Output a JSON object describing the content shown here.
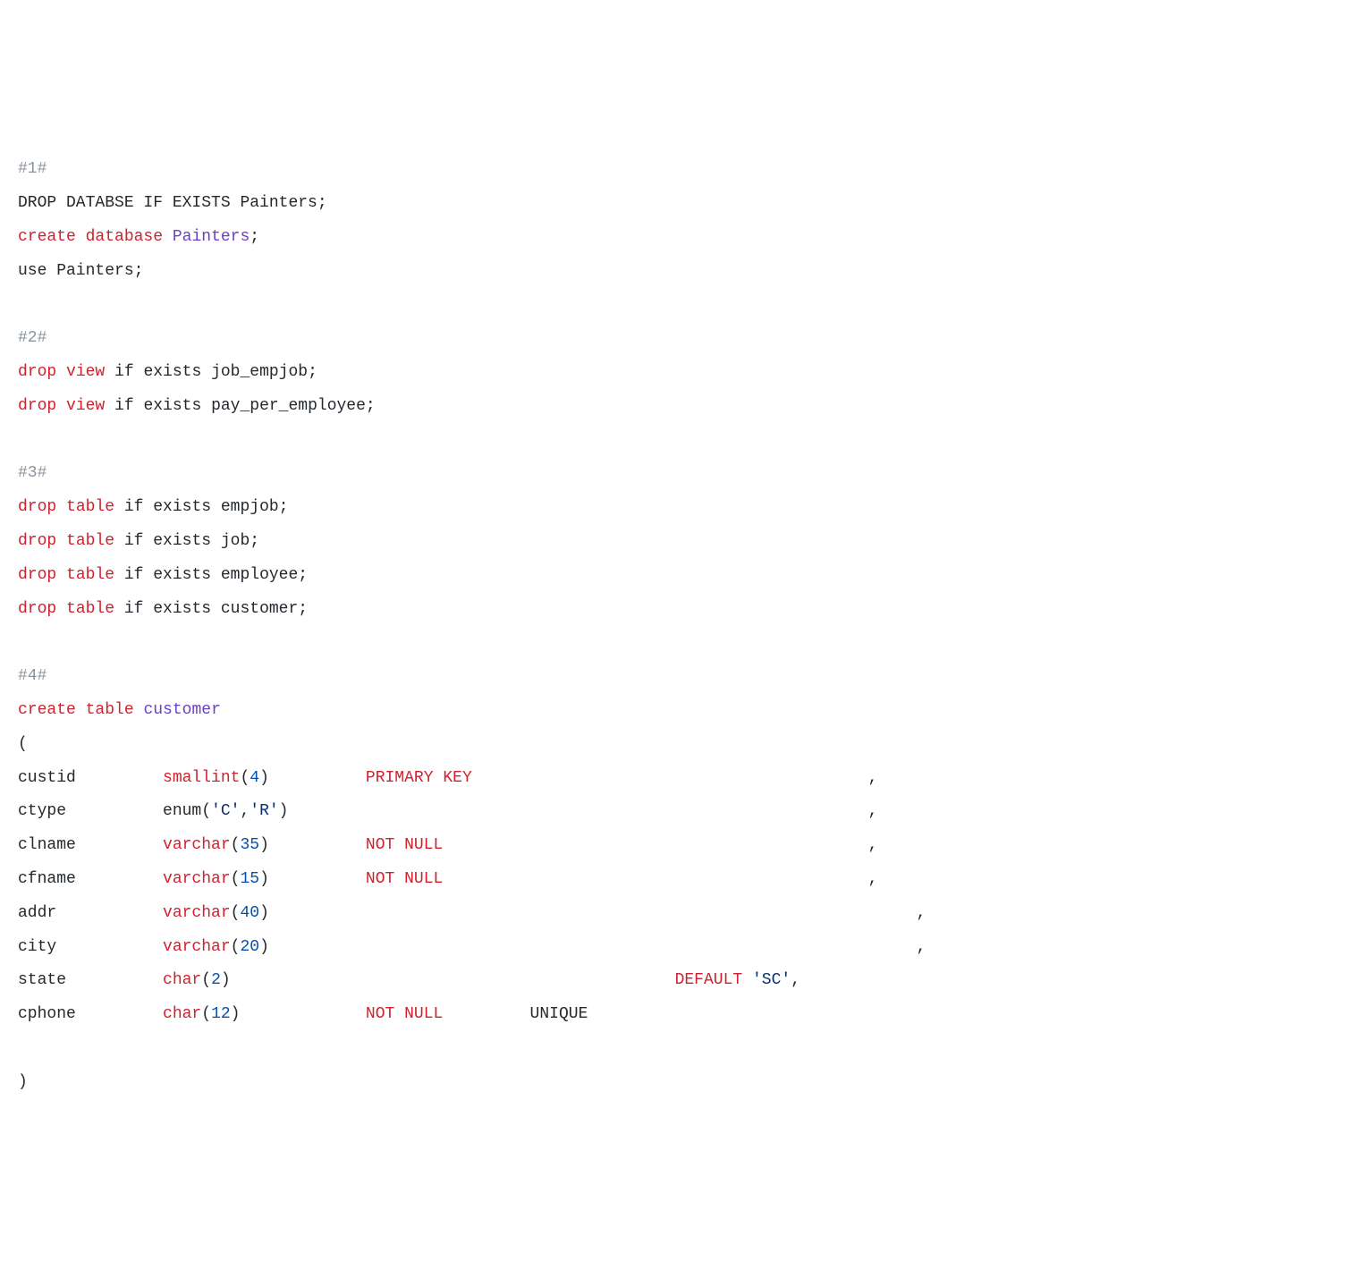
{
  "code": {
    "lines": [
      [
        {
          "cls": "tok-comment",
          "t": "#1#"
        }
      ],
      [
        {
          "cls": "tok-plain",
          "t": "DROP DATABSE IF EXISTS Painters;"
        }
      ],
      [
        {
          "cls": "tok-kw-red",
          "t": "create"
        },
        {
          "cls": "tok-plain",
          "t": " "
        },
        {
          "cls": "tok-kw-red",
          "t": "database"
        },
        {
          "cls": "tok-plain",
          "t": " "
        },
        {
          "cls": "tok-name",
          "t": "Painters"
        },
        {
          "cls": "tok-plain",
          "t": ";"
        }
      ],
      [
        {
          "cls": "tok-plain",
          "t": "use Painters;"
        }
      ],
      [
        {
          "cls": "tok-plain",
          "t": ""
        }
      ],
      [
        {
          "cls": "tok-comment",
          "t": "#2#"
        }
      ],
      [
        {
          "cls": "tok-kw-red",
          "t": "drop"
        },
        {
          "cls": "tok-plain",
          "t": " "
        },
        {
          "cls": "tok-kw-red",
          "t": "view"
        },
        {
          "cls": "tok-plain",
          "t": " if exists job_empjob;"
        }
      ],
      [
        {
          "cls": "tok-kw-red",
          "t": "drop"
        },
        {
          "cls": "tok-plain",
          "t": " "
        },
        {
          "cls": "tok-kw-red",
          "t": "view"
        },
        {
          "cls": "tok-plain",
          "t": " if exists pay_per_employee;"
        }
      ],
      [
        {
          "cls": "tok-plain",
          "t": ""
        }
      ],
      [
        {
          "cls": "tok-comment",
          "t": "#3#"
        }
      ],
      [
        {
          "cls": "tok-kw-red",
          "t": "drop"
        },
        {
          "cls": "tok-plain",
          "t": " "
        },
        {
          "cls": "tok-kw-red",
          "t": "table"
        },
        {
          "cls": "tok-plain",
          "t": " if exists empjob;"
        }
      ],
      [
        {
          "cls": "tok-kw-red",
          "t": "drop"
        },
        {
          "cls": "tok-plain",
          "t": " "
        },
        {
          "cls": "tok-kw-red",
          "t": "table"
        },
        {
          "cls": "tok-plain",
          "t": " if exists job;"
        }
      ],
      [
        {
          "cls": "tok-kw-red",
          "t": "drop"
        },
        {
          "cls": "tok-plain",
          "t": " "
        },
        {
          "cls": "tok-kw-red",
          "t": "table"
        },
        {
          "cls": "tok-plain",
          "t": " if exists employee;"
        }
      ],
      [
        {
          "cls": "tok-kw-red",
          "t": "drop"
        },
        {
          "cls": "tok-plain",
          "t": " "
        },
        {
          "cls": "tok-kw-red",
          "t": "table"
        },
        {
          "cls": "tok-plain",
          "t": " if exists customer;"
        }
      ],
      [
        {
          "cls": "tok-plain",
          "t": ""
        }
      ],
      [
        {
          "cls": "tok-comment",
          "t": "#4#"
        }
      ],
      [
        {
          "cls": "tok-kw-red",
          "t": "create"
        },
        {
          "cls": "tok-plain",
          "t": " "
        },
        {
          "cls": "tok-kw-red",
          "t": "table"
        },
        {
          "cls": "tok-plain",
          "t": " "
        },
        {
          "cls": "tok-name",
          "t": "customer"
        }
      ],
      [
        {
          "cls": "tok-plain",
          "t": "("
        }
      ],
      [
        {
          "cls": "tok-plain",
          "t": "custid         "
        },
        {
          "cls": "tok-kw-red",
          "t": "smallint"
        },
        {
          "cls": "tok-plain",
          "t": "("
        },
        {
          "cls": "tok-num",
          "t": "4"
        },
        {
          "cls": "tok-plain",
          "t": ")          "
        },
        {
          "cls": "tok-kw-red",
          "t": "PRIMARY"
        },
        {
          "cls": "tok-plain",
          "t": " "
        },
        {
          "cls": "tok-kw-red",
          "t": "KEY"
        },
        {
          "cls": "tok-plain",
          "t": "                                         ,"
        }
      ],
      [
        {
          "cls": "tok-plain",
          "t": "ctype          enum("
        },
        {
          "cls": "tok-str",
          "t": "'C'"
        },
        {
          "cls": "tok-plain",
          "t": ","
        },
        {
          "cls": "tok-str",
          "t": "'R'"
        },
        {
          "cls": "tok-plain",
          "t": ")                                                            ,"
        }
      ],
      [
        {
          "cls": "tok-plain",
          "t": "clname         "
        },
        {
          "cls": "tok-kw-red",
          "t": "varchar"
        },
        {
          "cls": "tok-plain",
          "t": "("
        },
        {
          "cls": "tok-num",
          "t": "35"
        },
        {
          "cls": "tok-plain",
          "t": ")          "
        },
        {
          "cls": "tok-kw-red",
          "t": "NOT"
        },
        {
          "cls": "tok-plain",
          "t": " "
        },
        {
          "cls": "tok-kw-red",
          "t": "NULL"
        },
        {
          "cls": "tok-plain",
          "t": "                                            ,"
        }
      ],
      [
        {
          "cls": "tok-plain",
          "t": "cfname         "
        },
        {
          "cls": "tok-kw-red",
          "t": "varchar"
        },
        {
          "cls": "tok-plain",
          "t": "("
        },
        {
          "cls": "tok-num",
          "t": "15"
        },
        {
          "cls": "tok-plain",
          "t": ")          "
        },
        {
          "cls": "tok-kw-red",
          "t": "NOT"
        },
        {
          "cls": "tok-plain",
          "t": " "
        },
        {
          "cls": "tok-kw-red",
          "t": "NULL"
        },
        {
          "cls": "tok-plain",
          "t": "                                            ,"
        }
      ],
      [
        {
          "cls": "tok-plain",
          "t": "addr           "
        },
        {
          "cls": "tok-kw-red",
          "t": "varchar"
        },
        {
          "cls": "tok-plain",
          "t": "("
        },
        {
          "cls": "tok-num",
          "t": "40"
        },
        {
          "cls": "tok-plain",
          "t": ")                                                                   ,"
        }
      ],
      [
        {
          "cls": "tok-plain",
          "t": "city           "
        },
        {
          "cls": "tok-kw-red",
          "t": "varchar"
        },
        {
          "cls": "tok-plain",
          "t": "("
        },
        {
          "cls": "tok-num",
          "t": "20"
        },
        {
          "cls": "tok-plain",
          "t": ")                                                                   ,"
        }
      ],
      [
        {
          "cls": "tok-plain",
          "t": "state          "
        },
        {
          "cls": "tok-kw-red",
          "t": "char"
        },
        {
          "cls": "tok-plain",
          "t": "("
        },
        {
          "cls": "tok-num",
          "t": "2"
        },
        {
          "cls": "tok-plain",
          "t": ")                                              "
        },
        {
          "cls": "tok-kw-red",
          "t": "DEFAULT"
        },
        {
          "cls": "tok-plain",
          "t": " "
        },
        {
          "cls": "tok-str",
          "t": "'SC'"
        },
        {
          "cls": "tok-plain",
          "t": ","
        }
      ],
      [
        {
          "cls": "tok-plain",
          "t": "cphone         "
        },
        {
          "cls": "tok-kw-red",
          "t": "char"
        },
        {
          "cls": "tok-plain",
          "t": "("
        },
        {
          "cls": "tok-num",
          "t": "12"
        },
        {
          "cls": "tok-plain",
          "t": ")             "
        },
        {
          "cls": "tok-kw-red",
          "t": "NOT"
        },
        {
          "cls": "tok-plain",
          "t": " "
        },
        {
          "cls": "tok-kw-red",
          "t": "NULL"
        },
        {
          "cls": "tok-plain",
          "t": "         UNIQUE"
        }
      ],
      [
        {
          "cls": "tok-plain",
          "t": ""
        }
      ],
      [
        {
          "cls": "tok-plain",
          "t": ")"
        }
      ]
    ]
  }
}
